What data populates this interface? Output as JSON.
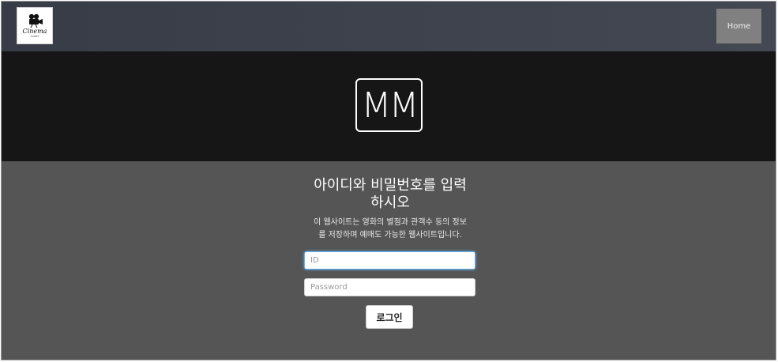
{
  "navbar": {
    "logo": {
      "text": "Cinema",
      "subtext": "TICKET",
      "icon": "film-camera-icon"
    },
    "home_label": "Home"
  },
  "hero": {
    "badge_text": "MM"
  },
  "login": {
    "title_line1": "아이디와 비밀번호를 입력",
    "title_line2": "하시오",
    "desc_line1": "이 웹사이트는 영화의 별점과 관객수 등의 정보",
    "desc_line2": "를 저장하며 예매도 가능한 웹사이트입니다.",
    "id_placeholder": "ID",
    "password_placeholder": "Password",
    "submit_label": "로그인"
  },
  "colors": {
    "navbar_bg": "#3e424c",
    "hero_bg": "#161616",
    "content_bg": "#555555",
    "home_button_bg": "#808080",
    "focus_ring": "#66afe9"
  }
}
